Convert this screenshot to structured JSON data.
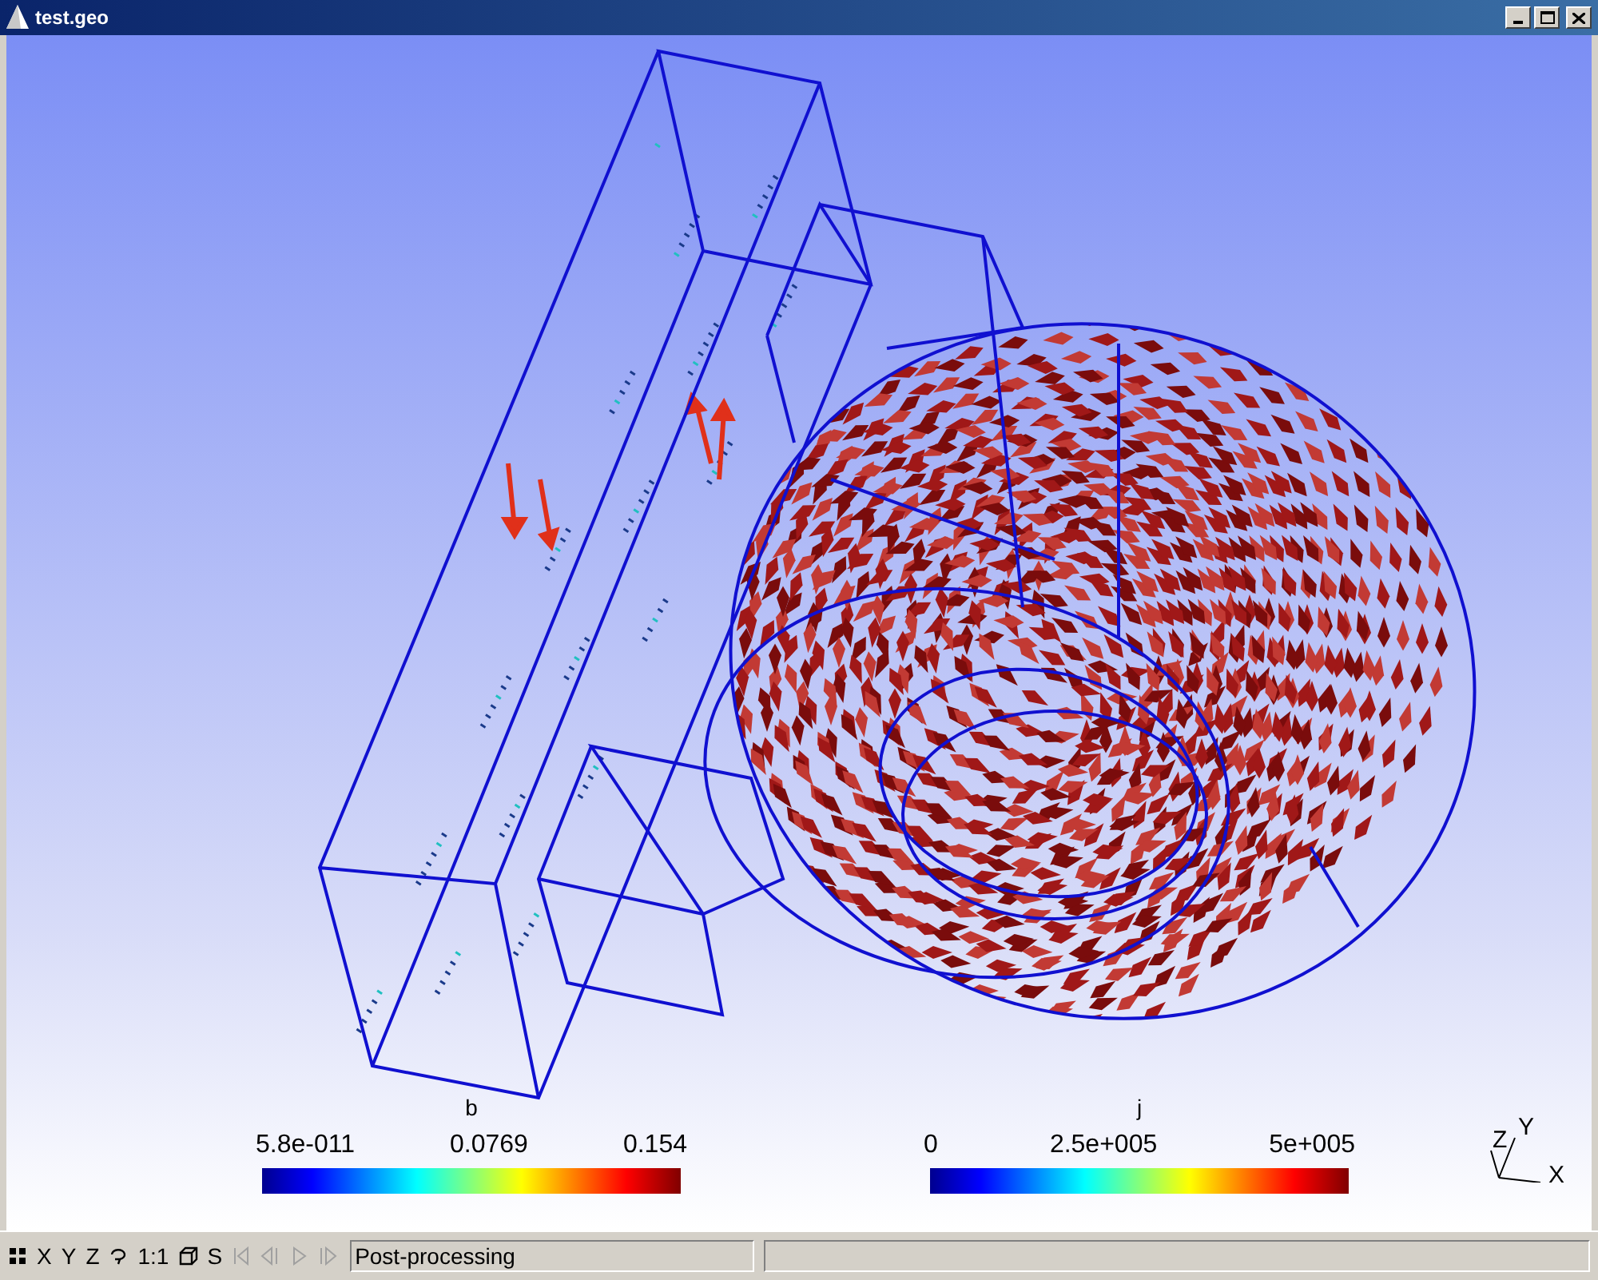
{
  "window": {
    "title": "test.geo"
  },
  "colorbars": [
    {
      "title": "b",
      "labels": [
        "5.8e-011",
        "0.0769",
        "0.154"
      ]
    },
    {
      "title": "j",
      "labels": [
        "0",
        "2.5e+005",
        "5e+005"
      ]
    }
  ],
  "axes": {
    "labels": [
      "Z",
      "Y",
      "X"
    ]
  },
  "toolbar": [
    {
      "kind": "grid",
      "disabled": false
    },
    {
      "kind": "text",
      "label": "X",
      "disabled": false
    },
    {
      "kind": "text",
      "label": "Y",
      "disabled": false
    },
    {
      "kind": "text",
      "label": "Z",
      "disabled": false
    },
    {
      "kind": "rotate",
      "disabled": false
    },
    {
      "kind": "text",
      "label": "1:1",
      "disabled": false
    },
    {
      "kind": "cube",
      "disabled": false
    },
    {
      "kind": "text",
      "label": "S",
      "disabled": false
    },
    {
      "kind": "first",
      "disabled": true
    },
    {
      "kind": "prev",
      "disabled": true
    },
    {
      "kind": "play",
      "disabled": true
    },
    {
      "kind": "next",
      "disabled": true
    }
  ],
  "status_bar": {
    "message": "Post-processing"
  }
}
